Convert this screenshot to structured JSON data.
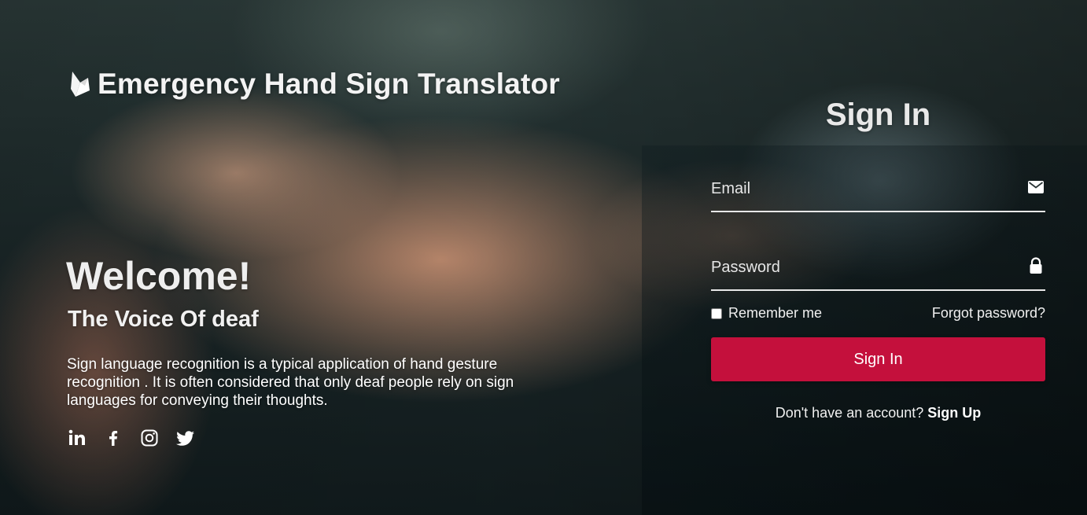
{
  "brand": {
    "icon": "brand-flame-icon",
    "title": "Emergency Hand Sign Translator"
  },
  "hero": {
    "welcome": "Welcome!",
    "tagline": "The Voice Of deaf",
    "description": "Sign language recognition is a typical application of hand gesture recognition . It is often considered that only deaf people rely on sign languages for conveying their thoughts."
  },
  "socials": [
    {
      "icon": "linkedin-icon"
    },
    {
      "icon": "facebook-icon"
    },
    {
      "icon": "instagram-icon"
    },
    {
      "icon": "twitter-icon"
    }
  ],
  "form": {
    "title": "Sign In",
    "email_placeholder": "Email",
    "email_icon": "envelope-icon",
    "password_placeholder": "Password",
    "password_icon": "lock-icon",
    "remember_label": "Remember me",
    "forgot_label": "Forgot password?",
    "submit_label": "Sign In",
    "signup_prompt": "Don't have an account?",
    "signup_link": "Sign Up"
  },
  "colors": {
    "accent": "#c4103c",
    "text": "#ffffff"
  }
}
